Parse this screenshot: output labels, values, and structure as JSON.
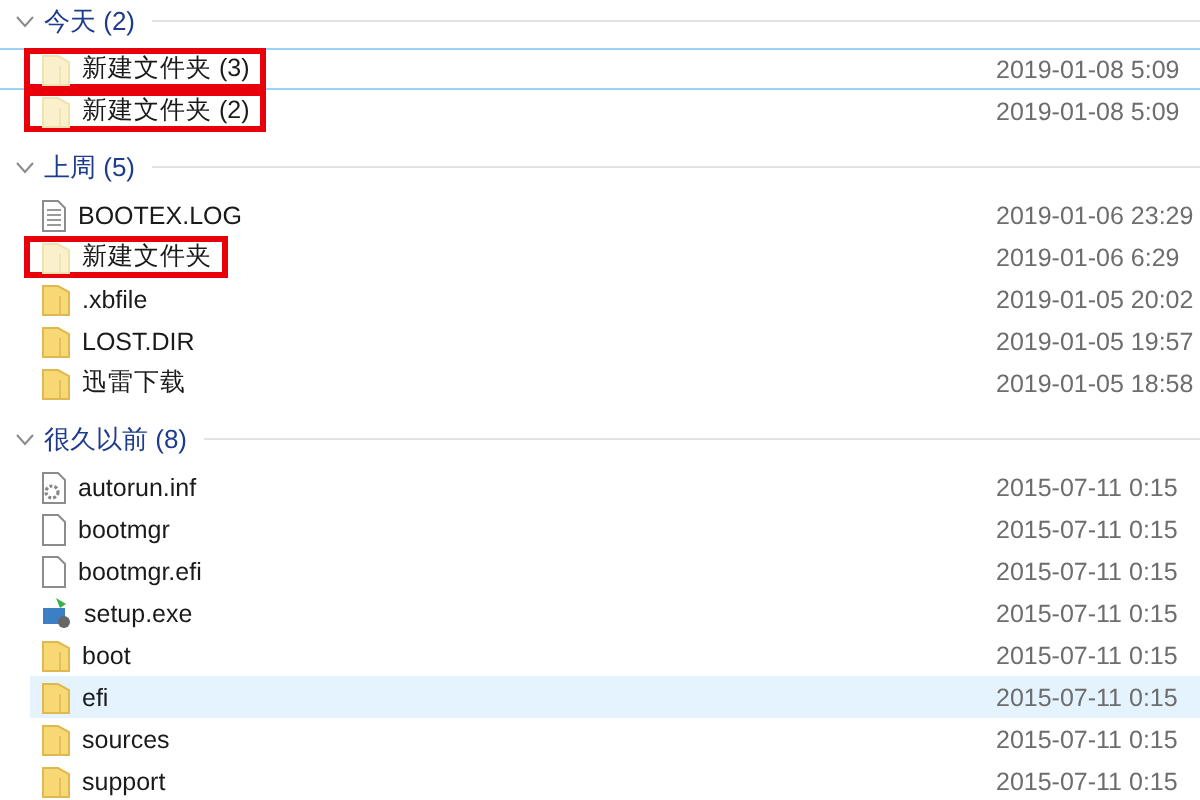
{
  "groups": [
    {
      "title": "今天 (2)",
      "expanded": true,
      "items": [
        {
          "name": "新建文件夹 (3)",
          "date": "2019-01-08 5:09",
          "kind": "folder-faded",
          "focused": true,
          "selected": false,
          "highlighted": true
        },
        {
          "name": "新建文件夹 (2)",
          "date": "2019-01-08 5:09",
          "kind": "folder-faded",
          "focused": false,
          "selected": false,
          "highlighted": true
        }
      ]
    },
    {
      "title": "上周 (5)",
      "expanded": true,
      "items": [
        {
          "name": "BOOTEX.LOG",
          "date": "2019-01-06 23:29",
          "kind": "text",
          "focused": false,
          "selected": false,
          "highlighted": false
        },
        {
          "name": "新建文件夹",
          "date": "2019-01-06 6:29",
          "kind": "folder-faded",
          "focused": false,
          "selected": false,
          "highlighted": true
        },
        {
          "name": ".xbfile",
          "date": "2019-01-05 20:02",
          "kind": "folder",
          "focused": false,
          "selected": false,
          "highlighted": false
        },
        {
          "name": "LOST.DIR",
          "date": "2019-01-05 19:57",
          "kind": "folder",
          "focused": false,
          "selected": false,
          "highlighted": false
        },
        {
          "name": "迅雷下载",
          "date": "2019-01-05 18:58",
          "kind": "folder",
          "focused": false,
          "selected": false,
          "highlighted": false
        }
      ]
    },
    {
      "title": "很久以前 (8)",
      "expanded": true,
      "items": [
        {
          "name": "autorun.inf",
          "date": "2015-07-11 0:15",
          "kind": "settings",
          "focused": false,
          "selected": false,
          "highlighted": false
        },
        {
          "name": "bootmgr",
          "date": "2015-07-11 0:15",
          "kind": "blank",
          "focused": false,
          "selected": false,
          "highlighted": false
        },
        {
          "name": "bootmgr.efi",
          "date": "2015-07-11 0:15",
          "kind": "blank",
          "focused": false,
          "selected": false,
          "highlighted": false
        },
        {
          "name": "setup.exe",
          "date": "2015-07-11 0:15",
          "kind": "setup",
          "focused": false,
          "selected": false,
          "highlighted": false
        },
        {
          "name": "boot",
          "date": "2015-07-11 0:15",
          "kind": "folder",
          "focused": false,
          "selected": false,
          "highlighted": false
        },
        {
          "name": "efi",
          "date": "2015-07-11 0:15",
          "kind": "folder",
          "focused": false,
          "selected": true,
          "highlighted": false
        },
        {
          "name": "sources",
          "date": "2015-07-11 0:15",
          "kind": "folder",
          "focused": false,
          "selected": false,
          "highlighted": false
        },
        {
          "name": "support",
          "date": "2015-07-11 0:15",
          "kind": "folder",
          "focused": false,
          "selected": false,
          "highlighted": false
        }
      ]
    }
  ]
}
